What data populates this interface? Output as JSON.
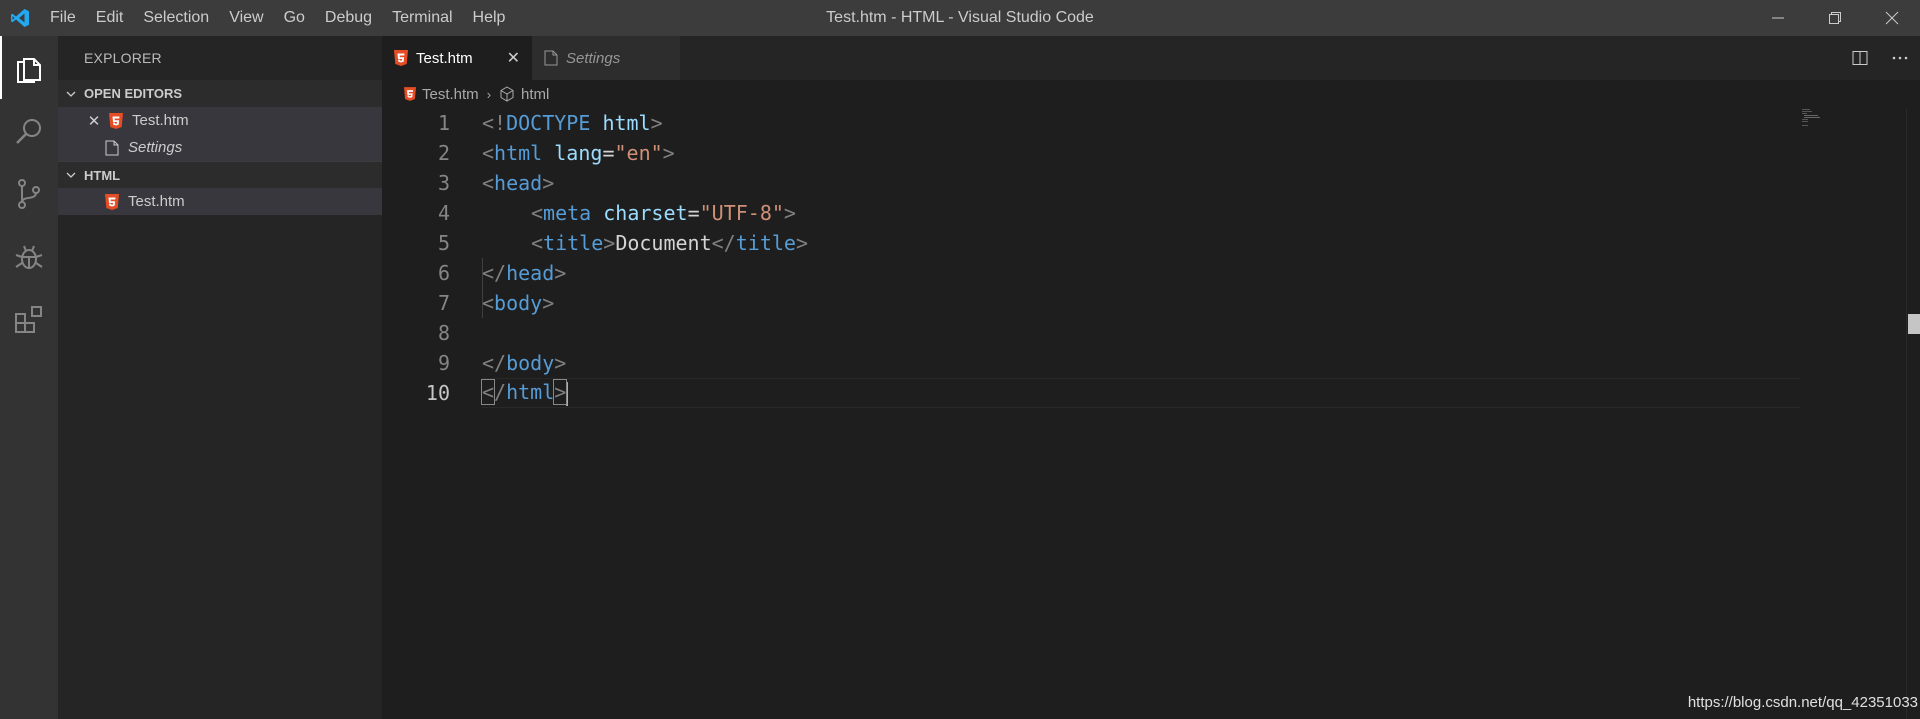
{
  "window": {
    "title": "Test.htm - HTML - Visual Studio Code"
  },
  "menu": [
    "File",
    "Edit",
    "Selection",
    "View",
    "Go",
    "Debug",
    "Terminal",
    "Help"
  ],
  "activity_bar": [
    "explorer-icon",
    "search-icon",
    "source-control-icon",
    "debug-icon",
    "extensions-icon"
  ],
  "sidebar": {
    "title": "EXPLORER",
    "open_editors": {
      "header": "OPEN EDITORS",
      "items": [
        {
          "label": "Test.htm",
          "icon": "html5-icon",
          "closable": true
        },
        {
          "label": "Settings",
          "icon": "file-icon",
          "italic": true
        }
      ]
    },
    "folder": {
      "header": "HTML",
      "items": [
        {
          "label": "Test.htm",
          "icon": "html5-icon"
        }
      ]
    }
  },
  "tabs": [
    {
      "label": "Test.htm",
      "active": true,
      "icon": "html5-icon"
    },
    {
      "label": "Settings",
      "active": false,
      "icon": "file-icon"
    }
  ],
  "breadcrumb": [
    "Test.htm",
    "html"
  ],
  "editor": {
    "lines": [
      "1",
      "2",
      "3",
      "4",
      "5",
      "6",
      "7",
      "8",
      "9",
      "10"
    ],
    "current_line": 10,
    "code": {
      "l1": {
        "open": "<!",
        "doctype": "DOCTYPE",
        "sp": " ",
        "name": "html",
        "close": ">"
      },
      "l2": {
        "open": "<",
        "tag": "html",
        "sp": " ",
        "attr": "lang",
        "eq": "=",
        "val": "\"en\"",
        "close": ">"
      },
      "l3": {
        "open": "<",
        "tag": "head",
        "close": ">"
      },
      "l4": {
        "open": "<",
        "tag": "meta",
        "sp": " ",
        "attr": "charset",
        "eq": "=",
        "val": "\"UTF-8\"",
        "close": ">"
      },
      "l5": {
        "open": "<",
        "tag": "title",
        "close": ">",
        "text": "Document",
        "open2": "</",
        "tag2": "title",
        "close2": ">"
      },
      "l6": {
        "open": "</",
        "tag": "head",
        "close": ">"
      },
      "l7": {
        "open": "<",
        "tag": "body",
        "close": ">"
      },
      "l9": {
        "open": "</",
        "tag": "body",
        "close": ">"
      },
      "l10": {
        "open": "<",
        "slash": "/",
        "tag": "html",
        "close": ">"
      }
    }
  },
  "watermark": "https://blog.csdn.net/qq_42351033",
  "colors": {
    "accent_logo": "#23a9f2",
    "html5_icon": "#e44d26",
    "tag": "#569cd6",
    "attr": "#9cdcfe",
    "string": "#ce9178"
  }
}
